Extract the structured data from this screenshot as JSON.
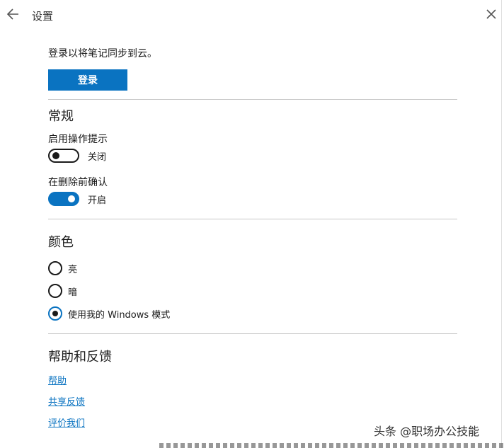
{
  "window": {
    "title": "设置",
    "back_icon": "arrow-left-icon",
    "close_icon": "close-icon"
  },
  "account": {
    "sync_text": "登录以将笔记同步到云。",
    "login_label": "登录"
  },
  "general": {
    "heading": "常规",
    "settings": [
      {
        "label": "启用操作提示",
        "state": "关闭",
        "on": false
      },
      {
        "label": "在删除前确认",
        "state": "开启",
        "on": true
      }
    ]
  },
  "color": {
    "heading": "颜色",
    "options": [
      {
        "label": "亮",
        "selected": false
      },
      {
        "label": "暗",
        "selected": false
      },
      {
        "label": "使用我的 Windows 模式",
        "selected": true
      }
    ]
  },
  "help": {
    "heading": "帮助和反馈",
    "links": [
      "帮助",
      "共享反馈",
      "评价我们"
    ]
  },
  "watermark": "头条 @职场办公技能",
  "colors": {
    "accent": "#0a73c1",
    "text": "#1a1a1a",
    "divider": "#c8c8c8"
  }
}
